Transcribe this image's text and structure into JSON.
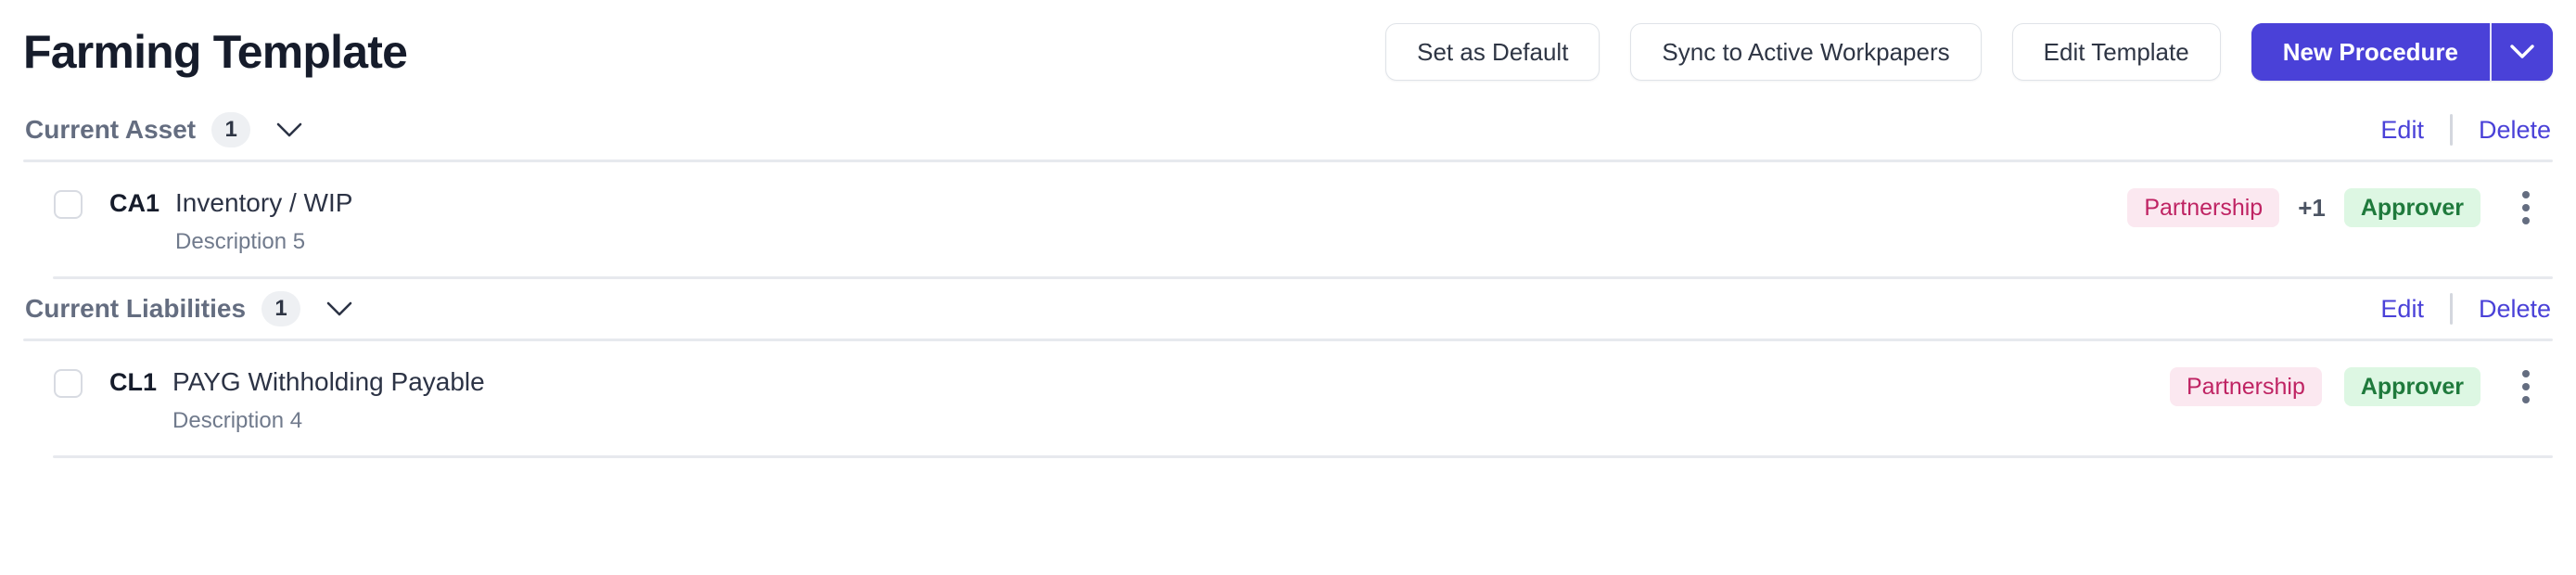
{
  "header": {
    "title": "Farming Template",
    "buttons": [
      {
        "label": "Set as Default",
        "name": "set-as-default-button"
      },
      {
        "label": "Sync to Active Workpapers",
        "name": "sync-to-active-workpapers-button"
      },
      {
        "label": "Edit Template",
        "name": "edit-template-button"
      }
    ],
    "primary_button": {
      "label": "New Procedure",
      "caret_icon": "chevron-down-icon",
      "color": "#4a41d8"
    }
  },
  "colors": {
    "accent": "#4a41d8",
    "link": "#4a41d8",
    "tag_pink_bg": "#fbe8f0",
    "tag_pink_text": "#bf2363",
    "tag_green_bg": "#ddf7e3",
    "tag_green_text": "#1f7a3c",
    "divider": "#e7e9ee",
    "title": "#161c2b"
  },
  "sections": [
    {
      "title": "Current Asset",
      "count": "1",
      "collapse_icon": "chevron-down-icon",
      "edit_label": "Edit",
      "delete_label": "Delete",
      "rows": [
        {
          "code": "CA1",
          "title": "Inventory / WIP",
          "description": "Description 5",
          "tag_entity": "Partnership",
          "more_count": "+1",
          "tag_role": "Approver",
          "menu_icon": "kebab-menu-icon"
        }
      ]
    },
    {
      "title": "Current Liabilities",
      "count": "1",
      "collapse_icon": "chevron-down-icon",
      "edit_label": "Edit",
      "delete_label": "Delete",
      "rows": [
        {
          "code": "CL1",
          "title": "PAYG Withholding Payable",
          "description": "Description 4",
          "tag_entity": "Partnership",
          "more_count": "",
          "tag_role": "Approver",
          "menu_icon": "kebab-menu-icon"
        }
      ]
    }
  ]
}
